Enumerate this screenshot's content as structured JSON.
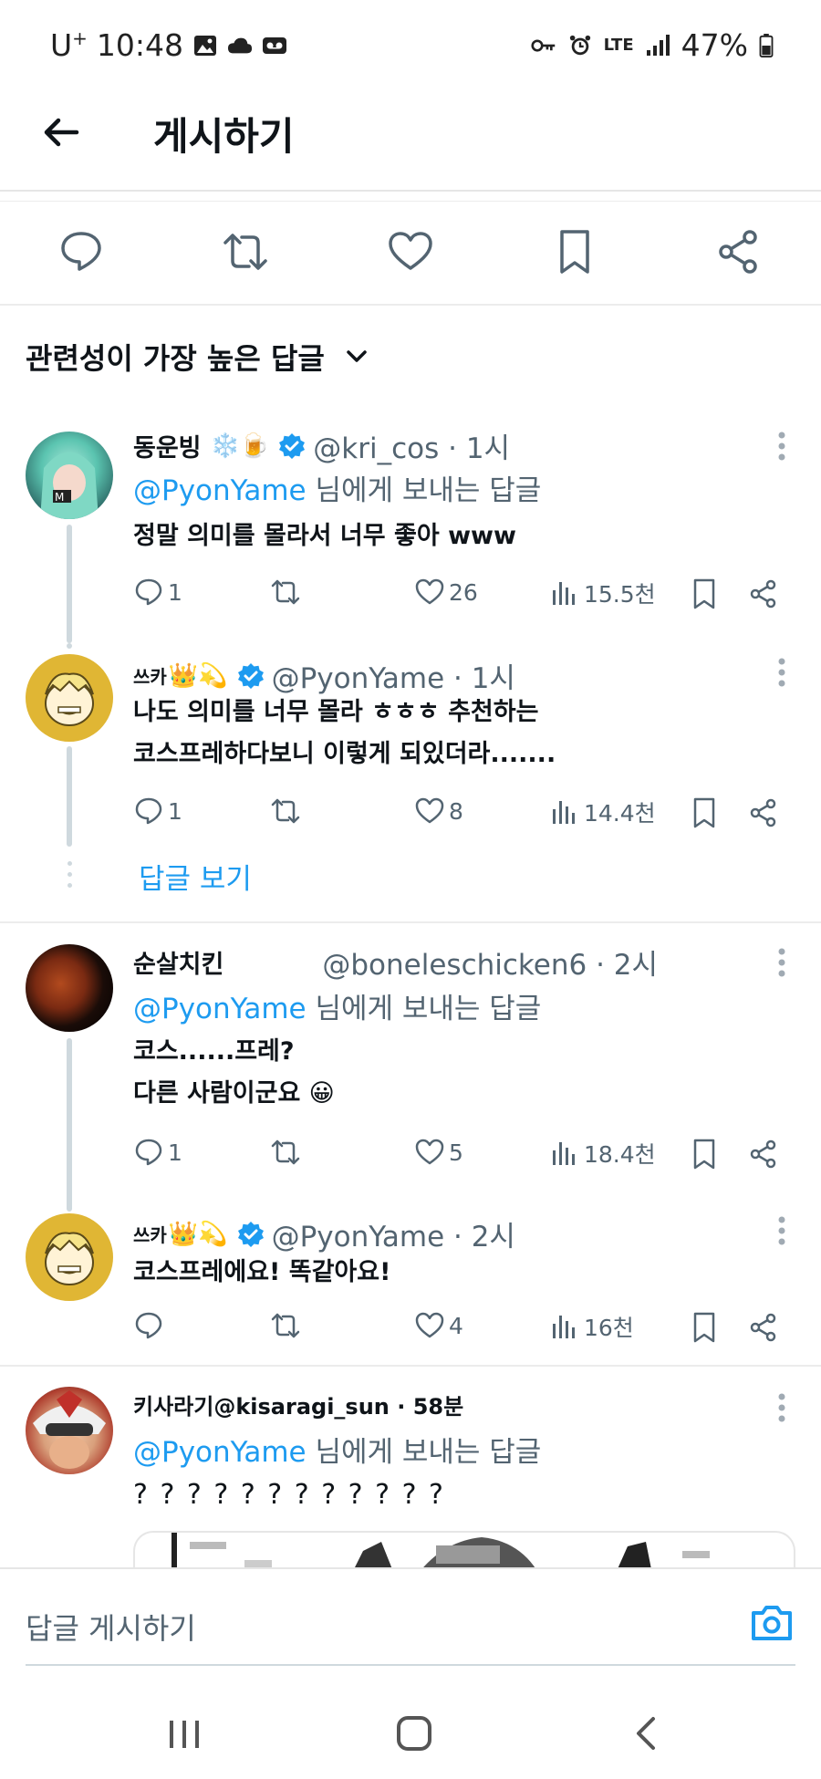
{
  "status_bar": {
    "carrier": "U",
    "carrier_sup": "+",
    "time": "10:48",
    "network": "LTE",
    "battery": "47%"
  },
  "header": {
    "title": "게시하기"
  },
  "sort": {
    "label": "관련성이 가장 높은 답글"
  },
  "replies": [
    {
      "name": "동운빙",
      "emojis": "❄️🍺",
      "handle": "@kri_cos · 1시",
      "replying_mention": "@PyonYame",
      "replying_suffix": " 님에게 보내는 답글",
      "lines": [
        "정말 의미를 몰라서 너무 좋아 www"
      ],
      "comments": "1",
      "reposts": "",
      "likes": "26",
      "views": "15.5천"
    },
    {
      "name": "쓰카",
      "emojis": "👑💫",
      "handle": "@PyonYame · 1시",
      "lines": [
        "나도 의미를 너무 몰라 ㅎㅎㅎ 추천하는",
        "코스프레하다보니 이렇게 되있더라......."
      ],
      "comments": "1",
      "reposts": "",
      "likes": "8",
      "views": "14.4천",
      "show_replies": "답글 보기"
    },
    {
      "name": "순살치킨",
      "emojis": "",
      "handle": "@boneleschicken6 · 2시",
      "replying_mention": "@PyonYame",
      "replying_suffix": " 님에게 보내는 답글",
      "lines": [
        "코스......프레?",
        "다른 사람이군요  😀"
      ],
      "comments": "1",
      "reposts": "",
      "likes": "5",
      "views": "18.4천"
    },
    {
      "name": "쓰카",
      "emojis": "👑💫",
      "handle": "@PyonYame · 2시",
      "lines": [
        "코스프레에요! 똑같아요!"
      ],
      "comments": "",
      "reposts": "",
      "likes": "4",
      "views": "16천"
    },
    {
      "name": "키사라기@kisaragi_sun · 58분",
      "emojis": "",
      "handle": "",
      "replying_mention": "@PyonYame",
      "replying_suffix": " 님에게 보내는 답글",
      "lines": [
        "? ? ? ? ? ? ? ? ? ? ? ?"
      ]
    }
  ],
  "compose": {
    "placeholder": "답글 게시하기"
  },
  "colors": {
    "accent": "#1d9bf0",
    "muted": "#536471",
    "verified": "#1d9bf0"
  }
}
